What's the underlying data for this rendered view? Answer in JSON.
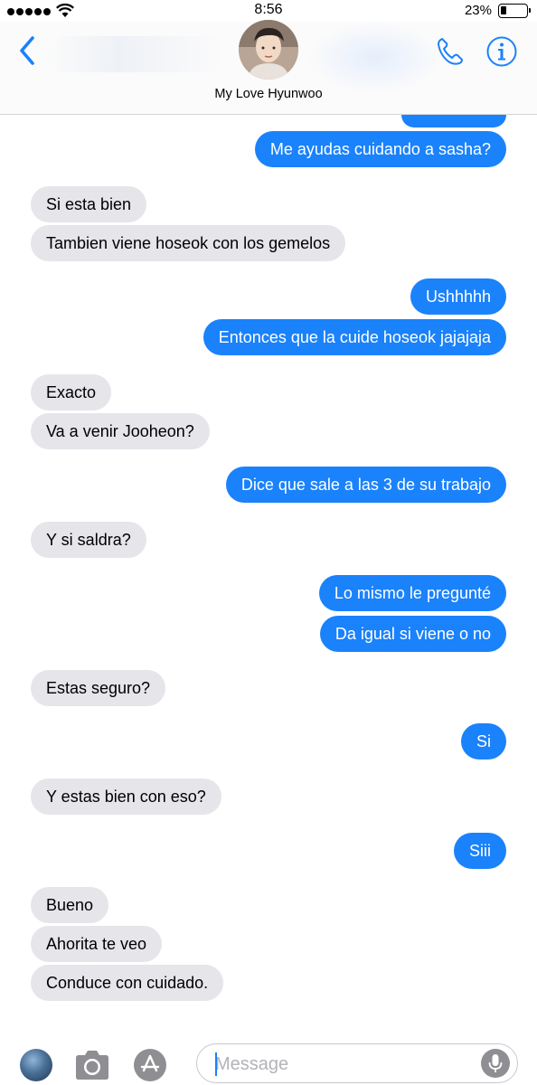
{
  "status_bar": {
    "time": "8:56",
    "battery_text": "23%",
    "battery_level": 0.23
  },
  "header": {
    "contact_name": "My Love Hyunwoo",
    "accent_color": "#1a82fb",
    "icons": [
      "chevron-left-icon",
      "phone-icon",
      "info-icon"
    ]
  },
  "messages": [
    {
      "side": "sent",
      "text": ""
    },
    {
      "side": "sent",
      "text": "Me ayudas cuidando a sasha?"
    },
    {
      "side": "received",
      "text": "Si esta bien"
    },
    {
      "side": "received",
      "text": "Tambien viene hoseok con los gemelos"
    },
    {
      "side": "sent",
      "text": "Ushhhhh"
    },
    {
      "side": "sent",
      "text": "Entonces que la cuide hoseok jajajaja"
    },
    {
      "side": "received",
      "text": "Exacto"
    },
    {
      "side": "received",
      "text": "Va a venir Jooheon?"
    },
    {
      "side": "sent",
      "text": "Dice que sale a las 3 de su trabajo"
    },
    {
      "side": "received",
      "text": "Y si saldra?"
    },
    {
      "side": "sent",
      "text": "Lo mismo le pregunté"
    },
    {
      "side": "sent",
      "text": "Da igual si viene o no"
    },
    {
      "side": "received",
      "text": "Estas seguro?"
    },
    {
      "side": "sent",
      "text": "Si"
    },
    {
      "side": "received",
      "text": "Y estas bien con eso?"
    },
    {
      "side": "sent",
      "text": "Siii"
    },
    {
      "side": "received",
      "text": "Bueno"
    },
    {
      "side": "received",
      "text": "Ahorita te veo"
    },
    {
      "side": "received",
      "text": "Conduce con cuidado."
    }
  ],
  "input_bar": {
    "placeholder": "Message",
    "value": "",
    "icons": [
      "photos-app-icon",
      "camera-icon",
      "app-store-icon",
      "microphone-icon"
    ]
  },
  "colors": {
    "sent_bubble": "#1a82fb",
    "received_bubble": "#e5e5ea"
  }
}
